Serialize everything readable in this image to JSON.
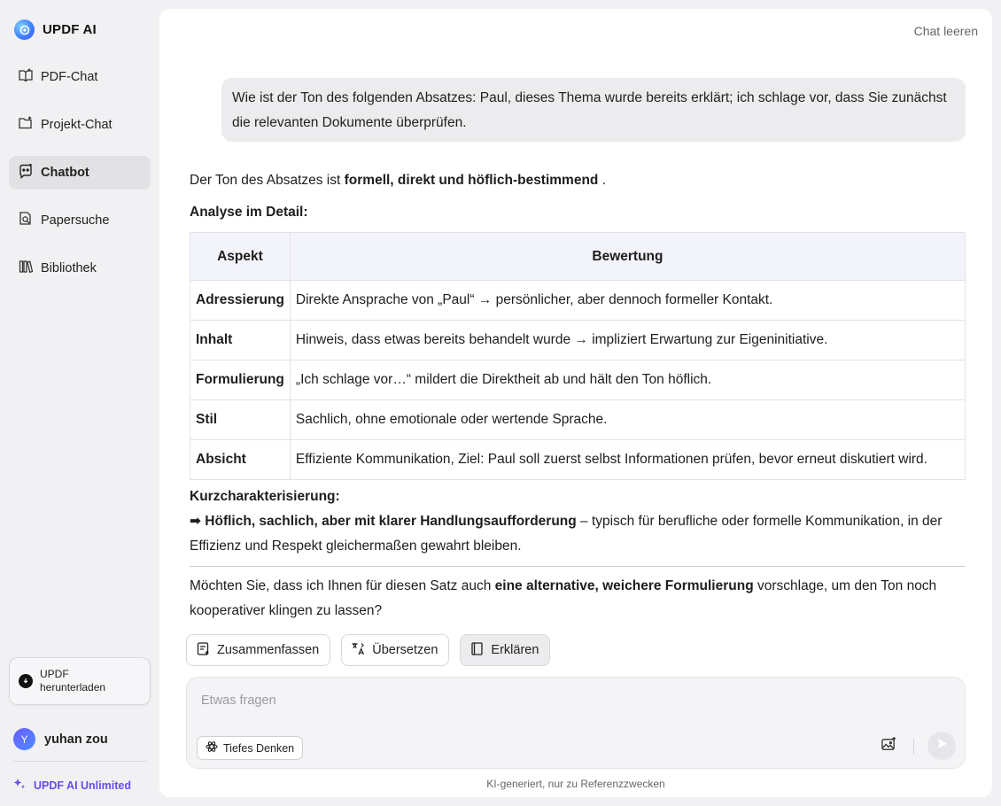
{
  "brand": {
    "name": "UPDF AI"
  },
  "sidebar": {
    "items": [
      {
        "label": "PDF-Chat",
        "icon": "book-open-icon",
        "active": false
      },
      {
        "label": "Projekt-Chat",
        "icon": "folder-plus-icon",
        "active": false
      },
      {
        "label": "Chatbot",
        "icon": "chatbot-icon",
        "active": true
      },
      {
        "label": "Papersuche",
        "icon": "paper-search-icon",
        "active": false
      },
      {
        "label": "Bibliothek",
        "icon": "library-icon",
        "active": false
      }
    ],
    "download_label": "UPDF herunterladen",
    "user": {
      "initial": "Y",
      "name": "yuhan zou"
    },
    "unlimited_label": "UPDF AI Unlimited"
  },
  "header": {
    "clear_chat": "Chat leeren"
  },
  "conversation": {
    "user_message": "Wie ist der Ton des folgenden Absatzes: Paul, dieses Thema wurde bereits erklärt; ich schlage vor, dass Sie zunächst die relevanten Dokumente überprüfen.",
    "answer": {
      "lead_text": "Der Ton des Absatzes ist ",
      "lead_bold": "formell, direkt und höflich-bestimmend",
      "lead_end": " .",
      "detail_heading": "Analyse im Detail:",
      "table": {
        "headers": [
          "Aspekt",
          "Bewertung"
        ],
        "rows": [
          [
            "Adressierung",
            "Direkte Ansprache von „Paul“ → persönlicher, aber dennoch formeller Kontakt."
          ],
          [
            "Inhalt",
            "Hinweis, dass etwas bereits behandelt wurde → impliziert Erwartung zur Eigeninitiative."
          ],
          [
            "Formulierung",
            "„Ich schlage vor…“ mildert die Direktheit ab und hält den Ton höflich."
          ],
          [
            "Stil",
            "Sachlich, ohne emotionale oder wertende Sprache."
          ],
          [
            "Absicht",
            "Effiziente Kommunikation, Ziel: Paul soll zuerst selbst Informationen prüfen, bevor erneut diskutiert wird."
          ]
        ]
      },
      "summary_heading": "Kurzcharakterisierung:",
      "summary_bold": "➡ Höflich, sachlich, aber mit klarer Handlungsaufforderung",
      "summary_rest": " – typisch für berufliche oder formelle Kommunikation, in der Effizienz und Respekt gleichermaßen gewahrt bleiben.",
      "question_start": "Möchten Sie, dass ich Ihnen für diesen Satz auch ",
      "question_bold": "eine alternative, weichere Formulierung",
      "question_end": " vorschlage, um den Ton noch kooperativer klingen zu lassen?"
    }
  },
  "actions": {
    "summarize": "Zusammenfassen",
    "translate": "Übersetzen",
    "explain": "Erklären"
  },
  "composer": {
    "placeholder": "Etwas fragen",
    "value": "",
    "deep_think": "Tiefes Denken"
  },
  "footer": {
    "disclaimer": "KI-generiert, nur zu Referenzzwecken"
  }
}
